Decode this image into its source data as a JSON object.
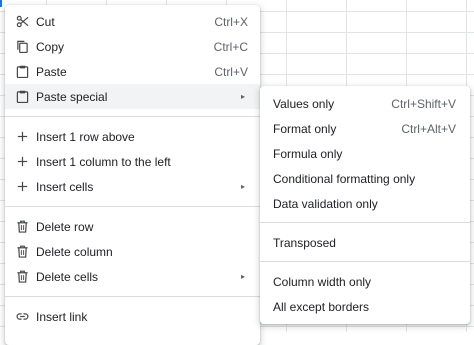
{
  "main_menu": {
    "items": [
      {
        "label": "Cut",
        "shortcut": "Ctrl+X",
        "icon": "scissors-icon"
      },
      {
        "label": "Copy",
        "shortcut": "Ctrl+C",
        "icon": "copy-icon"
      },
      {
        "label": "Paste",
        "shortcut": "Ctrl+V",
        "icon": "clipboard-icon"
      },
      {
        "label": "Paste special",
        "arrow": "▸",
        "icon": "clipboard-icon"
      },
      {
        "label": "Insert 1 row above",
        "icon": "plus-icon"
      },
      {
        "label": "Insert 1 column to the left",
        "icon": "plus-icon"
      },
      {
        "label": "Insert cells",
        "arrow": "▸",
        "icon": "plus-icon"
      },
      {
        "label": "Delete row",
        "icon": "trash-icon"
      },
      {
        "label": "Delete column",
        "icon": "trash-icon"
      },
      {
        "label": "Delete cells",
        "arrow": "▸",
        "icon": "trash-icon"
      },
      {
        "label": "Insert link",
        "icon": "link-icon"
      }
    ]
  },
  "paste_special_menu": {
    "items": [
      {
        "label": "Values only",
        "shortcut": "Ctrl+Shift+V"
      },
      {
        "label": "Format only",
        "shortcut": "Ctrl+Alt+V"
      },
      {
        "label": "Formula only"
      },
      {
        "label": "Conditional formatting only"
      },
      {
        "label": "Data validation only"
      },
      {
        "label": "Transposed"
      },
      {
        "label": "Column width only"
      },
      {
        "label": "All except borders"
      }
    ]
  },
  "colors": {
    "text": "#202124",
    "secondary_text": "#5f6368",
    "highlight": "#f1f3f4",
    "separator": "#dadce0",
    "grid": "#e2e3e3",
    "accent": "#1a73e8"
  }
}
